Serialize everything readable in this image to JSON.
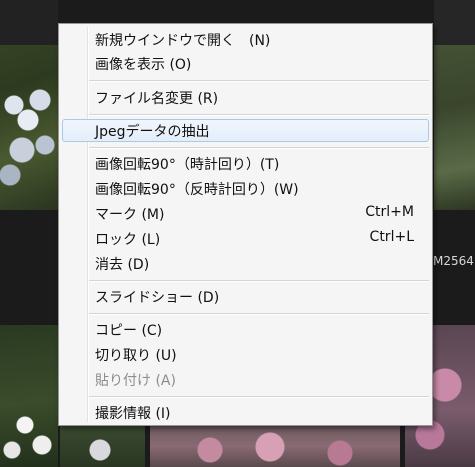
{
  "background": {
    "filename_partial": "M2564"
  },
  "menu": {
    "items": [
      {
        "label": "新規ウインドウで開く　(N)"
      },
      {
        "label": "画像を表示 (O)"
      },
      {
        "label": "ファイル名変更 (R)"
      },
      {
        "label": "Jpegデータの抽出"
      },
      {
        "label": "画像回転90°（時計回り）(T)"
      },
      {
        "label": "画像回転90°（反時計回り）(W)"
      },
      {
        "label": "マーク (M)",
        "shortcut": "Ctrl+M"
      },
      {
        "label": "ロック (L)",
        "shortcut": "Ctrl+L"
      },
      {
        "label": "消去 (D)"
      },
      {
        "label": "スライドショー (D)"
      },
      {
        "label": "コピー (C)"
      },
      {
        "label": "切り取り (U)"
      },
      {
        "label": "貼り付け (A)"
      },
      {
        "label": "撮影情報 (I)"
      }
    ]
  }
}
